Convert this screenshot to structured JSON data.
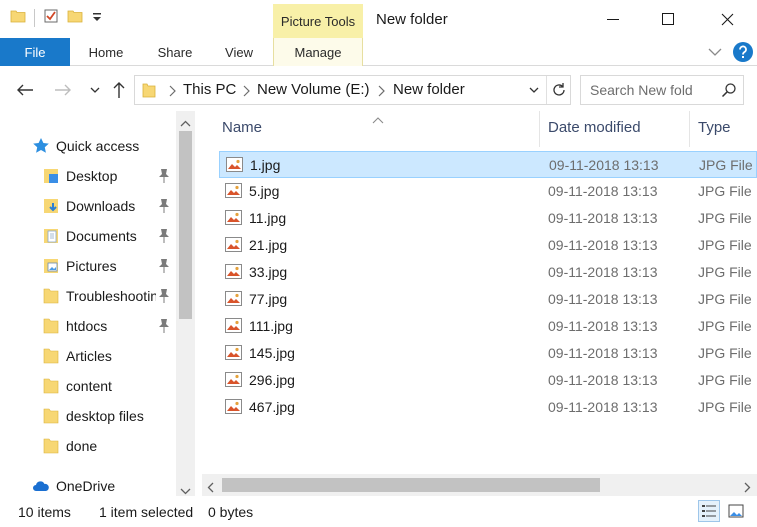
{
  "window": {
    "title": "New folder",
    "context_tab_header": "Picture Tools"
  },
  "ribbon": {
    "tabs": [
      {
        "label": "File"
      },
      {
        "label": "Home"
      },
      {
        "label": "Share"
      },
      {
        "label": "View"
      },
      {
        "label": "Manage"
      }
    ],
    "accent_color": "#1979ca"
  },
  "address": {
    "crumbs": [
      "This PC",
      "New Volume (E:)",
      "New folder"
    ]
  },
  "search": {
    "placeholder": "Search New fold"
  },
  "nav_pane": {
    "items": [
      {
        "label": "Quick access",
        "icon": "star-icon",
        "pinned": false
      },
      {
        "label": "Desktop",
        "icon": "desktop-folder-icon",
        "pinned": true
      },
      {
        "label": "Downloads",
        "icon": "downloads-folder-icon",
        "pinned": true
      },
      {
        "label": "Documents",
        "icon": "documents-folder-icon",
        "pinned": true
      },
      {
        "label": "Pictures",
        "icon": "pictures-folder-icon",
        "pinned": true
      },
      {
        "label": "Troubleshooting",
        "icon": "folder-icon",
        "pinned": true
      },
      {
        "label": "htdocs",
        "icon": "folder-icon",
        "pinned": true
      },
      {
        "label": "Articles",
        "icon": "folder-icon",
        "pinned": false
      },
      {
        "label": "content",
        "icon": "folder-icon",
        "pinned": false
      },
      {
        "label": "desktop files",
        "icon": "folder-icon",
        "pinned": false
      },
      {
        "label": "done",
        "icon": "folder-icon",
        "pinned": false
      },
      {
        "label": "OneDrive",
        "icon": "cloud-icon",
        "pinned": false
      }
    ]
  },
  "file_list": {
    "columns": {
      "name": "Name",
      "date": "Date modified",
      "type": "Type"
    },
    "rows": [
      {
        "name": "1.jpg",
        "date": "09-11-2018 13:13",
        "type": "JPG File",
        "selected": true
      },
      {
        "name": "5.jpg",
        "date": "09-11-2018 13:13",
        "type": "JPG File",
        "selected": false
      },
      {
        "name": "11.jpg",
        "date": "09-11-2018 13:13",
        "type": "JPG File",
        "selected": false
      },
      {
        "name": "21.jpg",
        "date": "09-11-2018 13:13",
        "type": "JPG File",
        "selected": false
      },
      {
        "name": "33.jpg",
        "date": "09-11-2018 13:13",
        "type": "JPG File",
        "selected": false
      },
      {
        "name": "77.jpg",
        "date": "09-11-2018 13:13",
        "type": "JPG File",
        "selected": false
      },
      {
        "name": "111.jpg",
        "date": "09-11-2018 13:13",
        "type": "JPG File",
        "selected": false
      },
      {
        "name": "145.jpg",
        "date": "09-11-2018 13:13",
        "type": "JPG File",
        "selected": false
      },
      {
        "name": "296.jpg",
        "date": "09-11-2018 13:13",
        "type": "JPG File",
        "selected": false
      },
      {
        "name": "467.jpg",
        "date": "09-11-2018 13:13",
        "type": "JPG File",
        "selected": false
      }
    ]
  },
  "status": {
    "item_count": "10 items",
    "selection": "1 item selected",
    "size": "0 bytes"
  }
}
